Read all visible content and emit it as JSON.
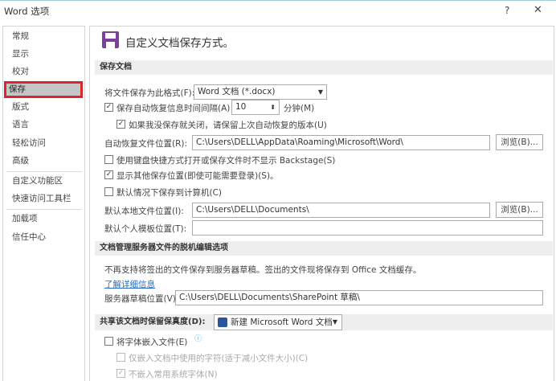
{
  "window": {
    "title": "Word 选项",
    "help": "?",
    "close": "✕"
  },
  "sidebar": {
    "items": [
      {
        "label": "常规"
      },
      {
        "label": "显示"
      },
      {
        "label": "校对"
      },
      {
        "label": "保存"
      },
      {
        "label": "版式"
      },
      {
        "label": "语言"
      },
      {
        "label": "轻松访问"
      },
      {
        "label": "高级"
      },
      {
        "label": "自定义功能区"
      },
      {
        "label": "快速访问工具栏"
      },
      {
        "label": "加载项"
      },
      {
        "label": "信任中心"
      }
    ],
    "selected": "保存"
  },
  "header": {
    "title": "自定义文档保存方式。",
    "accent": "#7b3f9e"
  },
  "save": {
    "section": "保存文档",
    "format_label": "将文件保存为此格式(F):",
    "format_value": "Word 文档 (*.docx)",
    "autosave_label": "保存自动恢复信息时间间隔(A)",
    "autosave_checked": true,
    "autosave_value": "10",
    "minutes": "分钟(M)",
    "keep_label": "如果我没保存就关闭，请保留上次自动恢复的版本(U)",
    "keep_checked": true,
    "autorecover_label": "自动恢复文件位置(R):",
    "autorecover_value": "C:\\Users\\DELL\\AppData\\Roaming\\Microsoft\\Word\\",
    "browse": "浏览(B)...",
    "backstage_label": "使用键盘快捷方式打开或保存文件时不显示 Backstage(S)",
    "backstage_checked": false,
    "other_label": "显示其他保存位置(即使可能需要登录)(S)。",
    "other_checked": true,
    "computer_label": "默认情况下保存到计算机(C)",
    "computer_checked": false,
    "local_label": "默认本地文件位置(I):",
    "local_value": "C:\\Users\\DELL\\Documents\\",
    "template_label": "默认个人模板位置(T):",
    "template_value": ""
  },
  "offline": {
    "section": "文档管理服务器文件的脱机编辑选项",
    "note": "不再支持将签出的文件保存到服务器草稿。签出的文件现将保存到 Office 文档缓存。",
    "link": "了解详细信息",
    "draft_label": "服务器草稿位置(V):",
    "draft_value": "C:\\Users\\DELL\\Documents\\SharePoint 草稿\\"
  },
  "fidelity": {
    "section": "共享该文档时保留保真度(D):",
    "doc": "新建 Microsoft Word 文档",
    "embed_label": "将字体嵌入文件(E)",
    "embed_checked": false,
    "only_used_label": "仅嵌入文档中使用的字符(适于减小文件大小)(C)",
    "only_used_checked": false,
    "no_system_label": "不嵌入常用系统字体(N)",
    "no_system_checked": true
  }
}
